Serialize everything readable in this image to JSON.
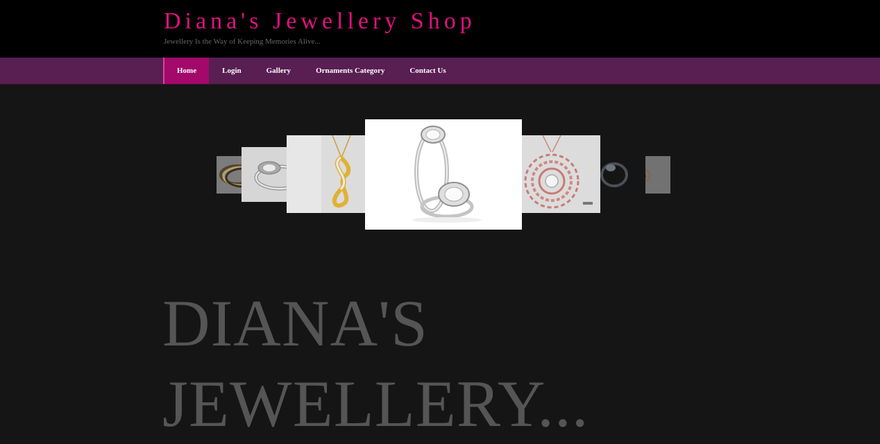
{
  "header": {
    "title": "Diana's Jewellery Shop",
    "tagline": "Jewellery Is the Way of Keeping Memories Alive..."
  },
  "nav": {
    "items": [
      {
        "label": "Home",
        "active": true
      },
      {
        "label": "Login"
      },
      {
        "label": "Gallery"
      },
      {
        "label": "Ornaments Category"
      },
      {
        "label": "Contact Us"
      }
    ]
  },
  "carousel": {
    "slides": [
      {
        "name": "bangles"
      },
      {
        "name": "diamond-ring"
      },
      {
        "name": "gold-pendant"
      },
      {
        "name": "halo-engagement-ring",
        "current": true
      },
      {
        "name": "rose-gold-pendant"
      },
      {
        "name": "dark-ring"
      },
      {
        "name": "blue-stone-pendant"
      }
    ]
  },
  "hero": {
    "line1": "DIANA'S",
    "line2": "JEWELLERY..."
  },
  "colors": {
    "accent": "#e0117f",
    "nav_bg": "#591e52",
    "nav_active": "#a3096a",
    "page_bg": "#151515"
  }
}
